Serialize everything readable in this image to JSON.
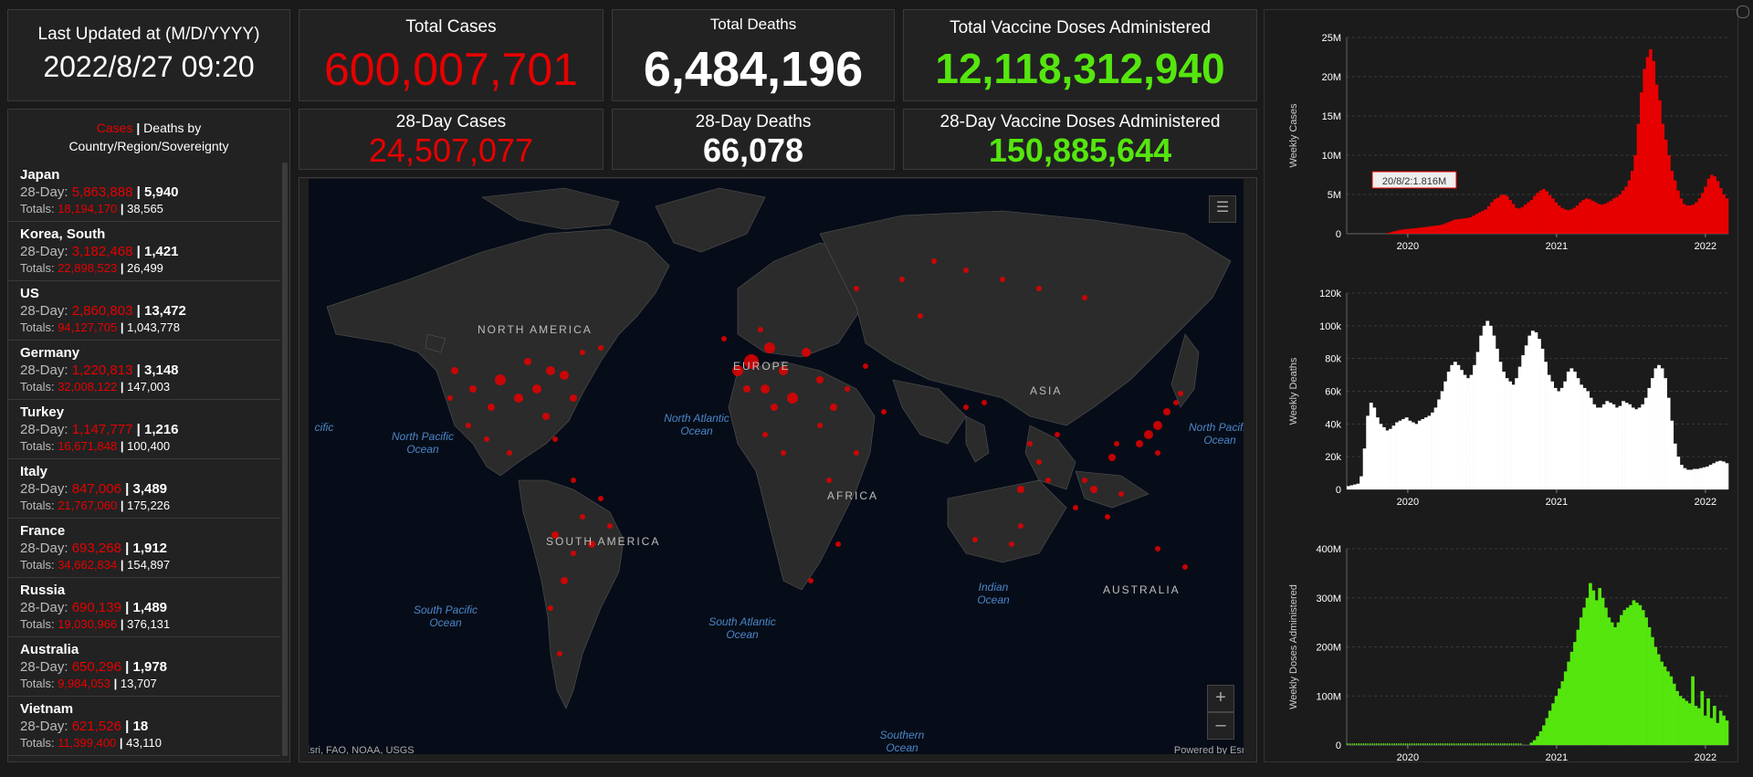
{
  "header": {
    "last_updated_label": "Last Updated at (M/D/YYYY)",
    "last_updated_value": "2022/8/27 09:20",
    "total_cases_label": "Total Cases",
    "total_cases_value": "600,007,701",
    "total_deaths_label": "Total Deaths",
    "total_deaths_value": "6,484,196",
    "total_vaccine_label": "Total Vaccine Doses Administered",
    "total_vaccine_value": "12,118,312,940",
    "cases28_label": "28-Day Cases",
    "cases28_value": "24,507,077",
    "deaths28_label": "28-Day Deaths",
    "deaths28_value": "66,078",
    "vaccine28_label": "28-Day Vaccine Doses Administered",
    "vaccine28_value": "150,885,644"
  },
  "list": {
    "head_cases": "Cases",
    "head_sep": " | ",
    "head_rest": "Deaths by",
    "head_line2": "Country/Region/Sovereignty",
    "row_label_28": "28-Day: ",
    "row_label_tot": "Totals: ",
    "items": [
      {
        "name": "Japan",
        "c28": "5,863,888",
        "d28": "5,940",
        "ct": "18,194,170",
        "dt": "38,565"
      },
      {
        "name": "Korea, South",
        "c28": "3,182,468",
        "d28": "1,421",
        "ct": "22,898,523",
        "dt": "26,499"
      },
      {
        "name": "US",
        "c28": "2,860,803",
        "d28": "13,472",
        "ct": "94,127,705",
        "dt": "1,043,778"
      },
      {
        "name": "Germany",
        "c28": "1,220,813",
        "d28": "3,148",
        "ct": "32,008,122",
        "dt": "147,003"
      },
      {
        "name": "Turkey",
        "c28": "1,147,777",
        "d28": "1,216",
        "ct": "16,671,848",
        "dt": "100,400"
      },
      {
        "name": "Italy",
        "c28": "847,006",
        "d28": "3,489",
        "ct": "21,767,060",
        "dt": "175,226"
      },
      {
        "name": "France",
        "c28": "693,268",
        "d28": "1,912",
        "ct": "34,662,834",
        "dt": "154,897"
      },
      {
        "name": "Russia",
        "c28": "690,139",
        "d28": "1,489",
        "ct": "19,030,966",
        "dt": "376,131"
      },
      {
        "name": "Australia",
        "c28": "650,296",
        "d28": "1,978",
        "ct": "9,984,053",
        "dt": "13,707"
      },
      {
        "name": "Vietnam",
        "c28": "621,526",
        "d28": "18",
        "ct": "11,399,400",
        "dt": "43,110"
      }
    ]
  },
  "map": {
    "labels": {
      "north_america": "NORTH AMERICA",
      "south_america": "SOUTH AMERICA",
      "europe": "EUROPE",
      "asia": "ASIA",
      "africa": "AFRICA",
      "australia": "AUSTRALIA",
      "north_pacific": "North Pacific Ocean",
      "north_pacific_right": "North Pacific Ocean",
      "north_atlantic": "North Atlantic Ocean",
      "south_pacific": "South Pacific Ocean",
      "south_atlantic": "South Atlantic Ocean",
      "indian": "Indian Ocean",
      "southern": "Southern Ocean",
      "cific": "cific"
    },
    "attribution": "Esri, FAO, NOAA, USGS",
    "powered_by": "Powered by Esri",
    "zoom_in": "+",
    "zoom_out": "–"
  },
  "colors": {
    "cases": "#e60000",
    "deaths": "#ffffff",
    "vaccine": "#55e60e"
  },
  "chart_data": [
    {
      "type": "bar",
      "ylabel": "Weekly Cases",
      "xticks": [
        "2020",
        "2021",
        "2022"
      ],
      "yticks": [
        "0",
        "5M",
        "10M",
        "15M",
        "20M",
        "25M"
      ],
      "ylim": [
        0,
        25000000
      ],
      "tooltip": "20/8/2:1.816M",
      "color": "#e60000",
      "values": [
        0,
        0,
        0,
        0,
        0,
        0,
        0,
        0,
        0,
        0,
        0,
        0,
        0,
        100000,
        200000,
        300000,
        400000,
        500000,
        550000,
        600000,
        620000,
        650000,
        700000,
        750000,
        800000,
        850000,
        900000,
        950000,
        1000000,
        1050000,
        1100000,
        1200000,
        1350000,
        1500000,
        1650000,
        1816000,
        1850000,
        1900000,
        1950000,
        2000000,
        2100000,
        2300000,
        2500000,
        2700000,
        2900000,
        3100000,
        3500000,
        4000000,
        4400000,
        4600000,
        4900000,
        5000000,
        4800000,
        4300000,
        3800000,
        3300000,
        3200000,
        3400000,
        3700000,
        4000000,
        4300000,
        4800000,
        5200000,
        5500000,
        5700000,
        5400000,
        4900000,
        4500000,
        4000000,
        3600000,
        3300000,
        3100000,
        3000000,
        3100000,
        3300000,
        3600000,
        4000000,
        4300000,
        4500000,
        4400000,
        4200000,
        4000000,
        3800000,
        3700000,
        3800000,
        4000000,
        4200000,
        4500000,
        4700000,
        5000000,
        5500000,
        6000000,
        6800000,
        8000000,
        10000000,
        14000000,
        18000000,
        21000000,
        22500000,
        23500000,
        22000000,
        19000000,
        17000000,
        14000000,
        12000000,
        10000000,
        8000000,
        6800000,
        5500000,
        4500000,
        3800000,
        3600000,
        3600000,
        3700000,
        4000000,
        4500000,
        5200000,
        6000000,
        7000000,
        7500000,
        7300000,
        6700000,
        5800000,
        5000000,
        4500000
      ]
    },
    {
      "type": "bar",
      "ylabel": "Weekly Deaths",
      "xticks": [
        "2020",
        "2021",
        "2022"
      ],
      "yticks": [
        "0",
        "20k",
        "40k",
        "60k",
        "80k",
        "100k",
        "120k"
      ],
      "ylim": [
        0,
        120000
      ],
      "color": "#ffffff",
      "values": [
        2000,
        2500,
        3000,
        3500,
        8000,
        25000,
        45000,
        53000,
        50000,
        44000,
        40000,
        38000,
        36000,
        37000,
        39000,
        41000,
        42000,
        43000,
        44000,
        42000,
        41000,
        40000,
        42000,
        43000,
        44000,
        45000,
        47000,
        50000,
        55000,
        60000,
        66000,
        72000,
        76000,
        78000,
        76000,
        73000,
        70000,
        68000,
        70000,
        76000,
        84000,
        94000,
        100000,
        103000,
        100000,
        94000,
        86000,
        78000,
        72000,
        68000,
        66000,
        64000,
        68000,
        75000,
        82000,
        88000,
        94000,
        97000,
        96000,
        92000,
        86000,
        78000,
        70000,
        66000,
        62000,
        60000,
        62000,
        66000,
        72000,
        74000,
        72000,
        68000,
        64000,
        62000,
        60000,
        56000,
        52000,
        50000,
        50000,
        52000,
        54000,
        53000,
        52000,
        50000,
        51000,
        54000,
        53000,
        52000,
        50000,
        49000,
        50000,
        52000,
        56000,
        62000,
        68000,
        74000,
        76000,
        74000,
        68000,
        56000,
        42000,
        28000,
        20000,
        15000,
        13000,
        12000,
        12000,
        12500,
        12500,
        13000,
        13500,
        14000,
        15000,
        16000,
        17000,
        17500,
        17000,
        16000
      ]
    },
    {
      "type": "bar",
      "ylabel": "Weekly Doses Administered",
      "xticks": [
        "2020",
        "2021",
        "2022"
      ],
      "yticks": [
        "0",
        "100M",
        "200M",
        "300M",
        "400M"
      ],
      "ylim": [
        0,
        400000000
      ],
      "color": "#55e60e",
      "values": [
        0,
        0,
        0,
        0,
        0,
        0,
        0,
        0,
        0,
        0,
        0,
        0,
        0,
        0,
        0,
        0,
        0,
        0,
        0,
        0,
        0,
        0,
        0,
        0,
        0,
        0,
        0,
        0,
        0,
        0,
        0,
        0,
        0,
        0,
        0,
        0,
        0,
        0,
        0,
        0,
        0,
        0,
        0,
        0,
        0,
        0,
        0,
        0,
        0,
        0,
        0,
        0,
        0,
        0,
        0,
        0,
        0,
        0,
        0,
        5000000,
        10000000,
        18000000,
        28000000,
        40000000,
        55000000,
        70000000,
        85000000,
        100000000,
        115000000,
        130000000,
        150000000,
        170000000,
        190000000,
        210000000,
        235000000,
        260000000,
        280000000,
        300000000,
        330000000,
        315000000,
        295000000,
        320000000,
        300000000,
        280000000,
        260000000,
        250000000,
        240000000,
        250000000,
        265000000,
        275000000,
        280000000,
        285000000,
        295000000,
        290000000,
        285000000,
        275000000,
        260000000,
        240000000,
        220000000,
        200000000,
        185000000,
        170000000,
        160000000,
        150000000,
        140000000,
        125000000,
        110000000,
        100000000,
        95000000,
        90000000,
        85000000,
        140000000,
        80000000,
        75000000,
        110000000,
        60000000,
        95000000,
        55000000,
        80000000,
        45000000,
        70000000,
        60000000,
        50000000
      ]
    }
  ]
}
